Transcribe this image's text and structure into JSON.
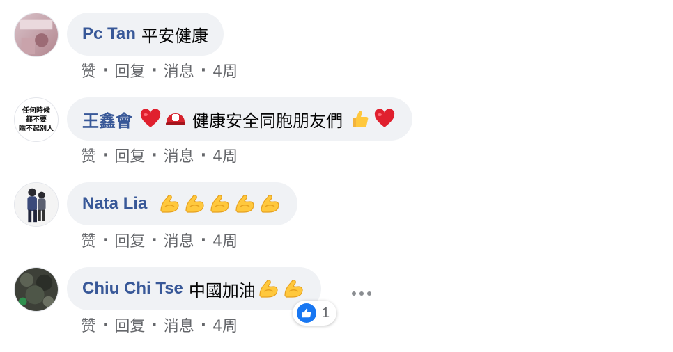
{
  "comments": [
    {
      "author": "Pc Tan",
      "text": "平安健康",
      "avatar": "photo-avatar",
      "emojis": [],
      "actions": {
        "like": "赞",
        "reply": "回复",
        "message": "消息",
        "time": "4周"
      }
    },
    {
      "author": "王鑫會",
      "text": "健康安全同胞朋友們",
      "avatar": "text-avatar",
      "avatar_lines": [
        "任何時候",
        "都不要",
        "瞧不起別人"
      ],
      "emojis_before": [
        "red-heart-icon",
        "rescue-helmet-icon"
      ],
      "emojis": [
        "thumbs-up-icon",
        "red-heart-icon"
      ],
      "actions": {
        "like": "赞",
        "reply": "回复",
        "message": "消息",
        "time": "4周"
      }
    },
    {
      "author": "Nata Lia",
      "text": "",
      "avatar": "photo-avatar",
      "emojis": [
        "flexed-biceps-icon",
        "flexed-biceps-icon",
        "flexed-biceps-icon",
        "flexed-biceps-icon",
        "flexed-biceps-icon"
      ],
      "actions": {
        "like": "赞",
        "reply": "回复",
        "message": "消息",
        "time": "4周"
      }
    },
    {
      "author": "Chiu Chi Tse",
      "text": "中國加油",
      "avatar": "photo-avatar",
      "emojis": [
        "flexed-biceps-icon",
        "flexed-biceps-icon"
      ],
      "actions": {
        "like": "赞",
        "reply": "回复",
        "message": "消息",
        "time": "4周"
      },
      "reaction": {
        "icon": "like-icon",
        "count": "1"
      }
    }
  ],
  "colors": {
    "author_link": "#385898",
    "bubble_bg": "#f0f2f5",
    "meta_text": "#65676b",
    "like_blue": "#1877f2"
  }
}
